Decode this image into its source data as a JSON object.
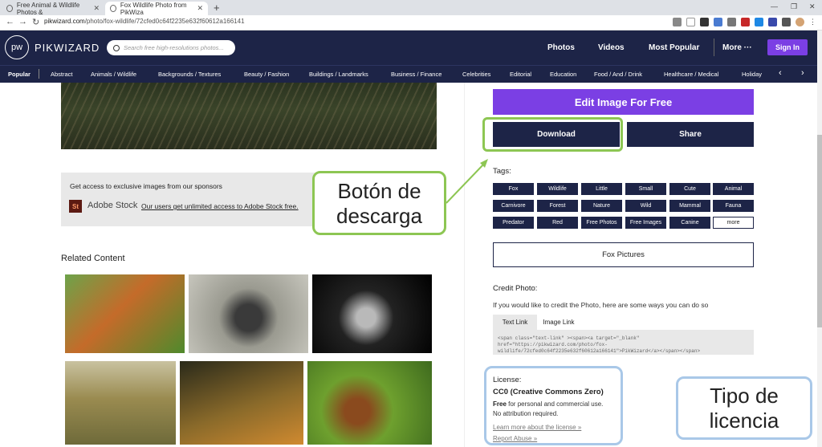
{
  "browser": {
    "tabs": [
      {
        "label": "Free Animal & Wildlife Photos &",
        "close": "✕"
      },
      {
        "label": "Fox Wildlife Photo from PikWiza",
        "close": "✕"
      }
    ],
    "new_tab": "+",
    "url_domain": "pikwizard.com",
    "url_path": "/photo/fox-wildlife/72cfed0c64f2235e632f60612a166141"
  },
  "header": {
    "logo": "pw",
    "brand": "PIKWIZARD",
    "search_placeholder": "Search free high-resolutions photos...",
    "nav": [
      "Photos",
      "Videos",
      "Most Popular",
      "More ···"
    ],
    "sign_in": "Sign In"
  },
  "categories": [
    "Popular",
    "Abstract",
    "Animals / Wildlife",
    "Backgrounds / Textures",
    "Beauty / Fashion",
    "Buildings / Landmarks",
    "Business / Finance",
    "Celebrities",
    "Editorial",
    "Education",
    "Food / And / Drink",
    "Healthcare / Medical",
    "Holiday"
  ],
  "category_arrows": [
    "‹",
    "›"
  ],
  "sponsor": {
    "title": "Get access to exclusive images from our sponsors",
    "logo": "St",
    "name": "Adobe Stock",
    "link": "Our users get unlimited access to Adobe Stock free."
  },
  "related": {
    "title": "Related Content"
  },
  "actions": {
    "edit": "Edit Image For Free",
    "download": "Download",
    "share": "Share"
  },
  "tags": {
    "label": "Tags:",
    "items": [
      "Fox",
      "Wildlife",
      "Little",
      "Small",
      "Cute",
      "Animal",
      "Carnivore",
      "Forest",
      "Nature",
      "Wild",
      "Mammal",
      "Fauna",
      "Predator",
      "Red",
      "Free Photos",
      "Free Images",
      "Canine",
      "more"
    ]
  },
  "fox_pictures": "Fox Pictures",
  "credit": {
    "title": "Credit Photo:",
    "desc": "If you would like to credit the Photo, here are some ways you can do so",
    "tabs": [
      "Text Link",
      "Image Link"
    ],
    "code": "<span class=\"text-link\" ><span><a target=\"_blank\" href=\"https://pikwizard.com/photo/fox-wildlife/72cfed0c64f2235e632f60612a166141\">PikWizard</a></span></span>"
  },
  "license": {
    "heading": "License:",
    "name": "CC0 (Creative Commons Zero)",
    "free_bold": "Free",
    "free_rest": " for personal and commercial use.",
    "attribution": "No attribution required.",
    "learn_more": "Learn more about the license »",
    "report": "Report Abuse »"
  },
  "callouts": {
    "download": [
      "Botón de",
      "descarga"
    ],
    "license": [
      "Tipo de",
      "licencia"
    ]
  },
  "colors": {
    "navy": "#1d2447",
    "purple": "#7b3fe4",
    "green_highlight": "#8dc653",
    "blue_highlight": "#a9c8e8"
  }
}
